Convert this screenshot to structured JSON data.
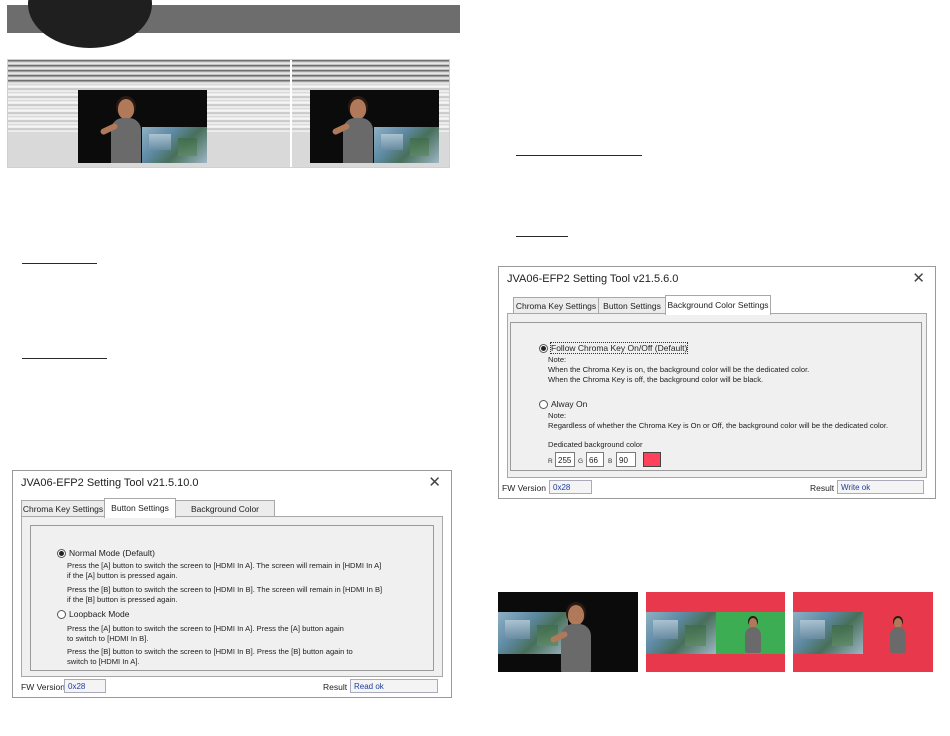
{
  "colors": {
    "header_bar": "#6d6d6d",
    "chroma_red": "#e8384b",
    "chroma_green": "#3cad52",
    "field_text": "#1f3ea0"
  },
  "button_dialog": {
    "title": "JVA06-EFP2 Setting Tool v21.5.10.0",
    "close_glyph": "✕",
    "tabs": [
      "Chroma Key Settings",
      "Button Settings",
      "Background Color Settings"
    ],
    "active_tab": "Button Settings",
    "options": [
      {
        "label": "Normal Mode (Default)",
        "selected": true,
        "lines": [
          "Press the [A] button to switch the screen to [HDMI In A]. The screen will remain in [HDMI In A]",
          "if the [A] button is pressed again.",
          "Press the [B] button to switch the screen to [HDMI In B]. The screen will remain in [HDMI In  B]",
          "if the [B] button is pressed again."
        ]
      },
      {
        "label": "Loopback Mode",
        "selected": false,
        "lines": [
          "Press the [A] button to switch the screen to [HDMI In A]. Press the [A] button again",
          "to switch to [HDMI In B].",
          "Press the [B] button to switch the screen to [HDMI In B]. Press the  [B] button again to",
          "switch to [HDMI In A]."
        ]
      }
    ],
    "fw_label": "FW Version :",
    "fw_value": "0x28",
    "result_label": "Result :",
    "result_value": "Read ok"
  },
  "bg_dialog": {
    "title": "JVA06-EFP2 Setting Tool v21.5.6.0",
    "close_glyph": "✕",
    "tabs": [
      "Chroma Key Settings",
      "Button Settings",
      "Background Color Settings"
    ],
    "active_tab": "Background Color Settings",
    "options": [
      {
        "label": "Follow Chroma Key On/Off (Default)",
        "selected": true,
        "note_title": "Note:",
        "lines": [
          "When the Chroma Key is on, the background color will be the dedicated color.",
          "When the Chroma Key is off, the background color will be black."
        ]
      },
      {
        "label": "Alway On",
        "selected": false,
        "note_title": "Note:",
        "lines": [
          "Regardless of whether the Chroma Key is On or Off, the background color will be the dedicated color."
        ]
      }
    ],
    "dedicated_label": "Dedicated background color",
    "rgb": {
      "r_label": "R",
      "r_value": "255",
      "g_label": "G",
      "g_value": "66",
      "b_label": "B",
      "b_value": "90"
    },
    "swatch_color": "#ff425a",
    "fw_label": "FW Version :",
    "fw_value": "0x28",
    "result_label": "Result :",
    "result_value": "Write ok"
  }
}
